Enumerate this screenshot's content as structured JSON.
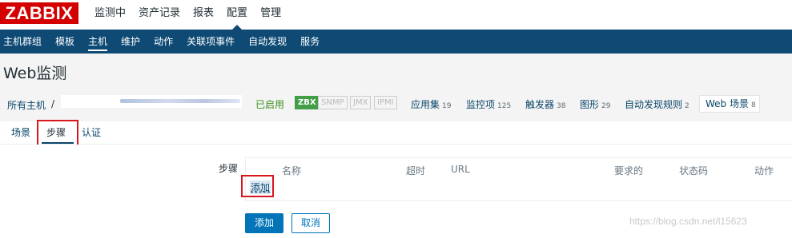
{
  "app": {
    "logo": "ZABBIX"
  },
  "topnav": [
    "监测中",
    "资产记录",
    "报表",
    "配置",
    "管理"
  ],
  "subnav": [
    "主机群组",
    "模板",
    "主机",
    "维护",
    "动作",
    "关联项事件",
    "自动发现",
    "服务"
  ],
  "page": {
    "title": "Web监测"
  },
  "breadcrumb": {
    "all_hosts": "所有主机",
    "separator": "/",
    "status": "已启用",
    "badges": [
      "ZBX",
      "SNMP",
      "JMX",
      "IPMI"
    ],
    "links": [
      {
        "label": "应用集",
        "count": "19"
      },
      {
        "label": "监控项",
        "count": "125"
      },
      {
        "label": "触发器",
        "count": "38"
      },
      {
        "label": "图形",
        "count": "29"
      },
      {
        "label": "自动发现规则",
        "count": "2"
      },
      {
        "label": "Web 场景",
        "count": "8"
      }
    ]
  },
  "tabs": [
    "场景",
    "步骤",
    "认证"
  ],
  "form": {
    "steps_label": "步骤",
    "columns": [
      "名称",
      "超时",
      "URL",
      "要求的",
      "状态码",
      "动作"
    ],
    "add_link": "添加",
    "add_button": "添加",
    "cancel_button": "取消"
  },
  "watermark": "https://blog.csdn.net/l15623",
  "colors": {
    "logo_bg": "#d40000",
    "nav_bg": "#0e4a74",
    "link": "#0a466a",
    "enabled": "#3b8e1d",
    "zbx_badge": "#429e47",
    "button": "#0275b8",
    "highlight_box": "#d8161c"
  }
}
